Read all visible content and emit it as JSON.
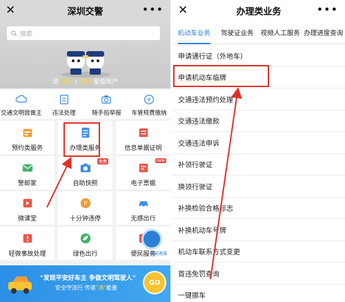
{
  "left": {
    "title": "深圳交警",
    "search_placeholder": "搜索",
    "greeting": {
      "pre": "请",
      "mid1": "登录",
      "sep": " / ",
      "mid2": "注册",
      "post": " 星级用户"
    },
    "quick": [
      {
        "label": "交通文明我做主",
        "icon": "cloud-icon"
      },
      {
        "label": "违法处理",
        "icon": "fine-icon"
      },
      {
        "label": "随手拍举报",
        "icon": "camera-icon"
      },
      {
        "label": "车管规费缴纳",
        "icon": "yen-icon"
      }
    ],
    "grid": [
      {
        "label": "预约类服务",
        "icon": "calendar-icon",
        "color": "#f29c38"
      },
      {
        "label": "办理类服务",
        "icon": "document-icon",
        "color": "#3a8ee6"
      },
      {
        "label": "信息单据证明",
        "icon": "certificate-icon",
        "color": "#e65a4a"
      },
      {
        "label": "警邮家",
        "icon": "mail-icon",
        "color": "#46b26b"
      },
      {
        "label": "自助快照",
        "icon": "camera-icon",
        "color": "#3a8ee6",
        "tag": "免费"
      },
      {
        "label": "电子票据",
        "icon": "ticket-icon",
        "color": "#e65a4a",
        "tag": "new"
      },
      {
        "label": "微课堂",
        "icon": "classroom-icon",
        "color": "#e65a4a"
      },
      {
        "label": "十分钟违停",
        "icon": "parking-icon",
        "color": "#f29c38"
      },
      {
        "label": "无感出行",
        "icon": "car-icon",
        "color": "#3a8ee6"
      },
      {
        "label": "轻微事故处理",
        "icon": "accident-icon",
        "color": "#e65a4a"
      },
      {
        "label": "绿色出行",
        "icon": "leaf-icon",
        "color": "#46b26b"
      },
      {
        "label": "便民服务",
        "icon": "service-icon",
        "color": "#e65a4a"
      }
    ],
    "banner": {
      "line1": "\"发现平安好车主 争做文明驾驶人\"",
      "line2a": "安全守法行 传递",
      "line2b": "\"满\"",
      "line2c": "能量",
      "go": "GO"
    },
    "float_label": "智能客服"
  },
  "right": {
    "title": "办理类业务",
    "tabs": [
      "机动车业务",
      "驾驶证业务",
      "视频人工服务",
      "办理进度查询"
    ],
    "items": [
      "申请通行证（外地车）",
      "申请机动车临牌",
      "交通违法预约处理",
      "交通违法缴款",
      "交通违法申诉",
      "补领行驶证",
      "换领行驶证",
      "补换检验合格标志",
      "补换机动车号牌",
      "机动车联系方式变更",
      "首违免罚查询",
      "一键挪车"
    ]
  },
  "colors": {
    "accent": "#2b7fd6",
    "highlight": "#e0302a"
  }
}
